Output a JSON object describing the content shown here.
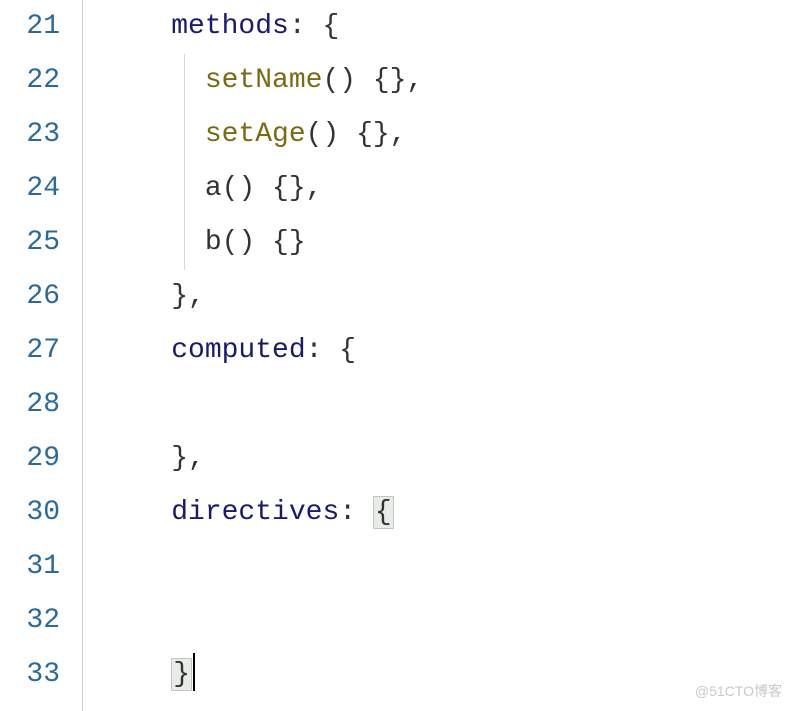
{
  "gutter": {
    "21": "21",
    "22": "22",
    "23": "23",
    "24": "24",
    "25": "25",
    "26": "26",
    "27": "27",
    "28": "28",
    "29": "29",
    "30": "30",
    "31": "31",
    "32": "32",
    "33": "33"
  },
  "code": {
    "l21_prop": "methods",
    "l21_rest": ": {",
    "l22_method": "setName",
    "l22_rest": "() {},",
    "l23_method": "setAge",
    "l23_rest": "() {},",
    "l24_method": "a",
    "l24_rest": "() {},",
    "l25_method": "b",
    "l25_rest": "() {}",
    "l26_rest": "},",
    "l27_prop": "computed",
    "l27_rest": ": {",
    "l28_rest": "",
    "l29_rest": "},",
    "l30_prop": "directives",
    "l30_rest": ": ",
    "l30_brace": "{",
    "l31_rest": "",
    "l32_rest": "",
    "l33_brace": "}",
    "indent2": "    ",
    "indent3": "      "
  },
  "watermark": "@51CTO博客"
}
